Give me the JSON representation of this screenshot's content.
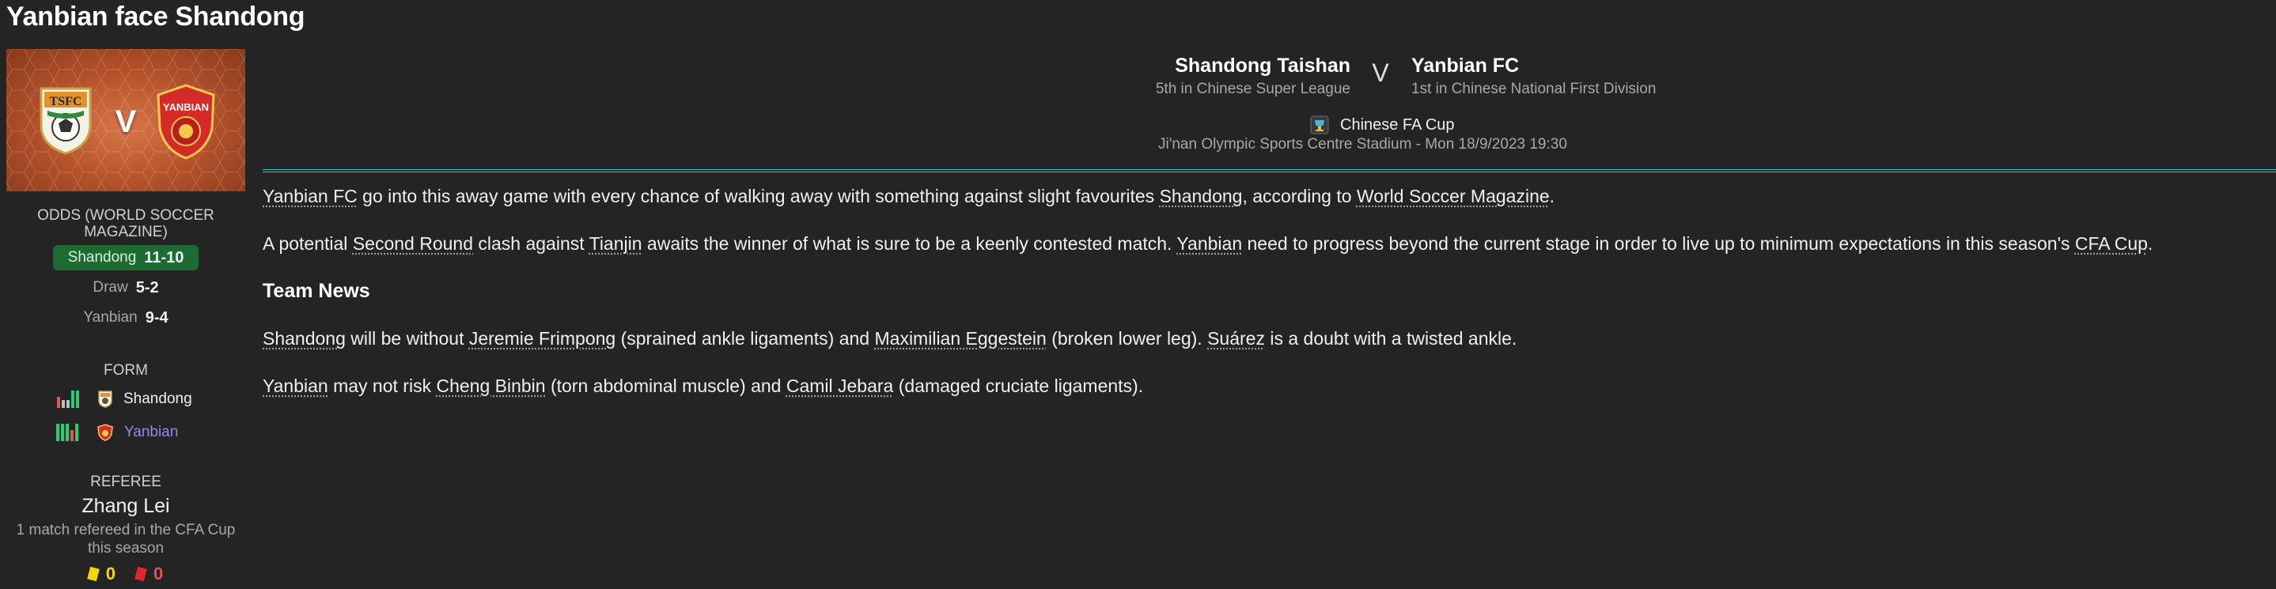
{
  "page": {
    "title": "Yanbian face Shandong"
  },
  "sidebar": {
    "banner": {
      "home_badge_text": "TSFC",
      "away_badge_text": "YANBIAN",
      "vs": "V"
    },
    "odds": {
      "heading": "ODDS (WORLD SOCCER MAGAZINE)",
      "rows": [
        {
          "name": "Shandong",
          "value": "11-10",
          "favourite": true
        },
        {
          "name": "Draw",
          "value": "5-2",
          "favourite": false
        },
        {
          "name": "Yanbian",
          "value": "9-4",
          "favourite": false
        }
      ]
    },
    "form": {
      "heading": "FORM",
      "rows": [
        {
          "team": "Shandong",
          "results": [
            "L",
            "D",
            "D",
            "W",
            "W"
          ]
        },
        {
          "team": "Yanbian",
          "results": [
            "W",
            "W",
            "W",
            "L",
            "W"
          ]
        }
      ]
    },
    "referee": {
      "heading": "REFEREE",
      "name": "Zhang Lei",
      "note": "1 match refereed in the CFA Cup this season",
      "yellow": "0",
      "red": "0"
    }
  },
  "fixture": {
    "home": {
      "name": "Shandong Taishan",
      "position": "5th in Chinese Super League"
    },
    "away": {
      "name": "Yanbian FC",
      "position": "1st in Chinese National First Division"
    },
    "vs": "V",
    "competition": "Chinese FA Cup",
    "venue": "Ji'nan Olympic Sports Centre Stadium - Mon 18/9/2023 19:30"
  },
  "article": {
    "p1": {
      "a": "Yanbian FC",
      "b": " go into this away game with every chance of walking away with something against slight favourites ",
      "c": "Shandong",
      "d": ", according to ",
      "e": "World Soccer Magazine",
      "f": "."
    },
    "p2": {
      "a": "A potential ",
      "b": "Second Round",
      "c": " clash against ",
      "d": "Tianjin",
      "e": " awaits the winner of what is sure to be a keenly contested match. ",
      "f": "Yanbian",
      "g": " need to progress beyond the current stage in order to live up to minimum expectations in this season's ",
      "h": "CFA Cup",
      "i": "."
    },
    "team_news_heading": "Team News",
    "p3": {
      "a": "Shandong",
      "b": " will be without ",
      "c": "Jeremie Frimpong",
      "d": " (sprained ankle ligaments) and ",
      "e": "Maximilian Eggestein",
      "f": " (broken lower leg). ",
      "g": "Suárez",
      "h": " is a doubt with a twisted ankle."
    },
    "p4": {
      "a": "Yanbian",
      "b": " may not risk ",
      "c": "Cheng Binbin",
      "d": " (torn abdominal muscle) and ",
      "e": "Camil Jebara",
      "f": " (damaged cruciate ligaments)."
    }
  },
  "colors": {
    "background": "#242424",
    "accent_divider": "#2cc8c8",
    "favourite_odds": "#1b6b33",
    "form_win": "#2ecc71",
    "form_loss": "#e0555a",
    "form_draw": "#bdbdbd",
    "yellow_card": "#f5d800",
    "red_card": "#e0262b"
  }
}
